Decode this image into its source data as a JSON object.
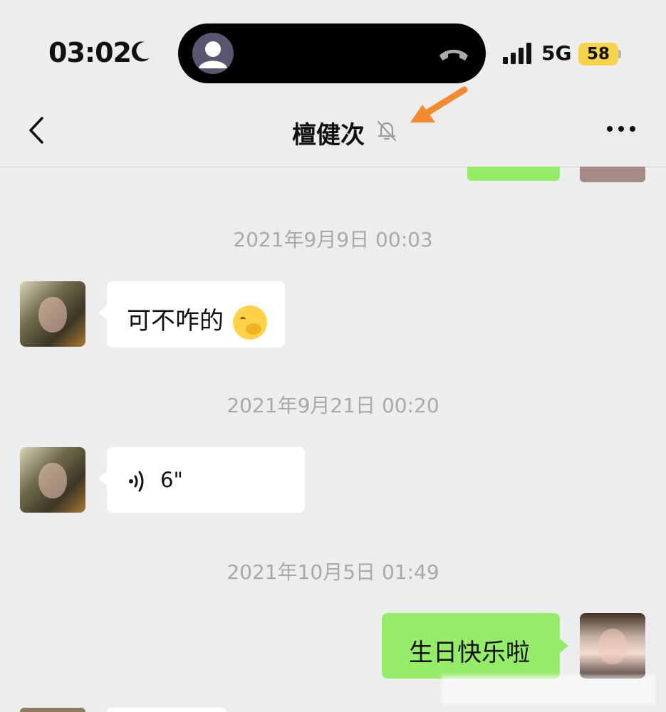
{
  "status_bar": {
    "time": "03:02",
    "network": "5G",
    "battery": "58",
    "icons": [
      "moon-icon",
      "person-icon",
      "phone-icon",
      "signal-icon"
    ]
  },
  "chat_header": {
    "title": "檀健次",
    "icons": [
      "back-icon",
      "mute-bell-icon",
      "more-icon",
      "orange-arrow-icon"
    ]
  },
  "messages": [
    {
      "timestamp": "2021年9月9日 00:03",
      "sender": "other",
      "text": "可不咋的",
      "emoji": "face-with-hand-over-mouth-icon"
    },
    {
      "timestamp": "2021年9月21日 00:20",
      "sender": "other",
      "type": "voice",
      "duration": "6\""
    },
    {
      "timestamp": "2021年10月5日 01:49",
      "sender": "me",
      "text": "生日快乐啦"
    }
  ],
  "colors": {
    "background": "#ededed",
    "my_bubble": "#95ec69",
    "other_bubble": "#ffffff",
    "battery": "#f5d547",
    "annotation_arrow": "#f28a30"
  }
}
